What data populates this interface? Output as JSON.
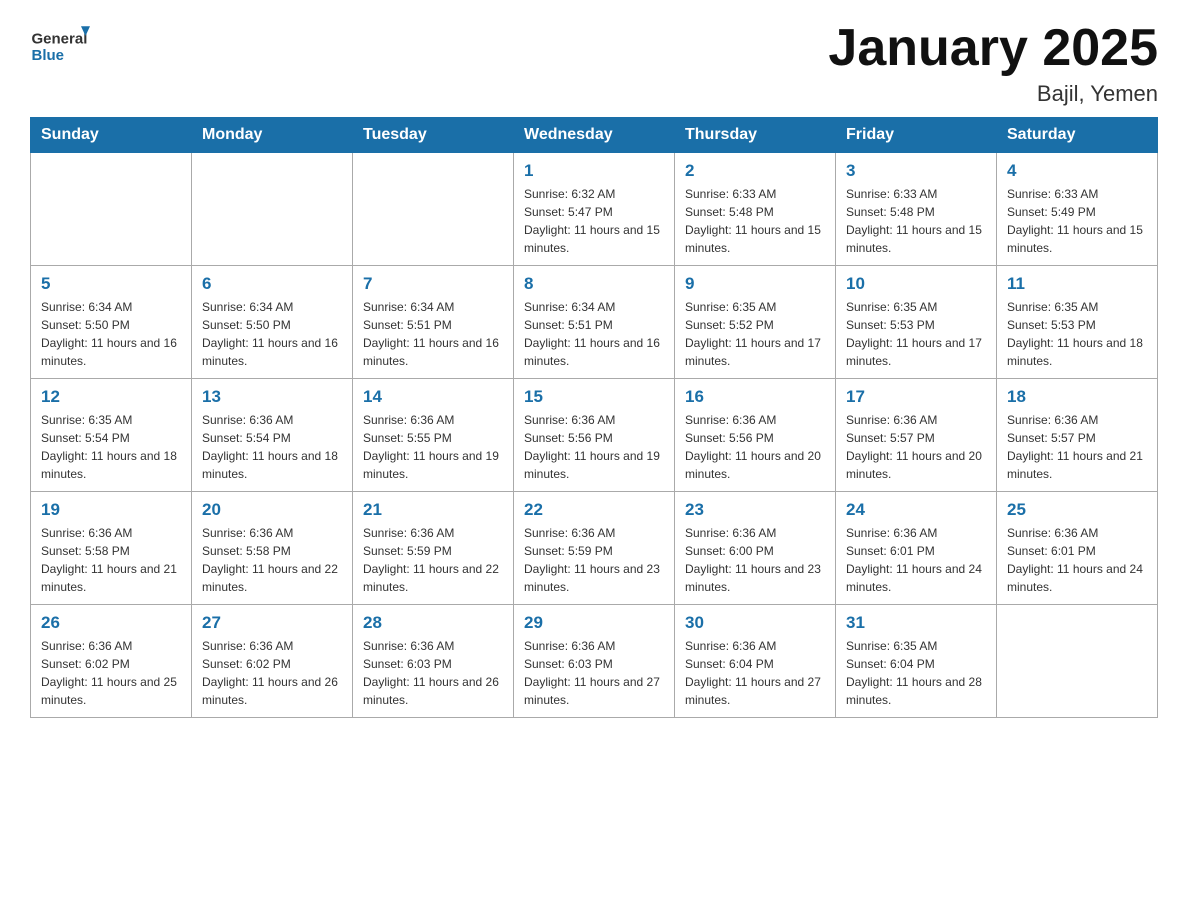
{
  "header": {
    "logo": {
      "general": "General",
      "blue": "Blue"
    },
    "title": "January 2025",
    "location": "Bajil, Yemen"
  },
  "days_of_week": [
    "Sunday",
    "Monday",
    "Tuesday",
    "Wednesday",
    "Thursday",
    "Friday",
    "Saturday"
  ],
  "weeks": [
    [
      {
        "day": "",
        "info": ""
      },
      {
        "day": "",
        "info": ""
      },
      {
        "day": "",
        "info": ""
      },
      {
        "day": "1",
        "info": "Sunrise: 6:32 AM\nSunset: 5:47 PM\nDaylight: 11 hours and 15 minutes."
      },
      {
        "day": "2",
        "info": "Sunrise: 6:33 AM\nSunset: 5:48 PM\nDaylight: 11 hours and 15 minutes."
      },
      {
        "day": "3",
        "info": "Sunrise: 6:33 AM\nSunset: 5:48 PM\nDaylight: 11 hours and 15 minutes."
      },
      {
        "day": "4",
        "info": "Sunrise: 6:33 AM\nSunset: 5:49 PM\nDaylight: 11 hours and 15 minutes."
      }
    ],
    [
      {
        "day": "5",
        "info": "Sunrise: 6:34 AM\nSunset: 5:50 PM\nDaylight: 11 hours and 16 minutes."
      },
      {
        "day": "6",
        "info": "Sunrise: 6:34 AM\nSunset: 5:50 PM\nDaylight: 11 hours and 16 minutes."
      },
      {
        "day": "7",
        "info": "Sunrise: 6:34 AM\nSunset: 5:51 PM\nDaylight: 11 hours and 16 minutes."
      },
      {
        "day": "8",
        "info": "Sunrise: 6:34 AM\nSunset: 5:51 PM\nDaylight: 11 hours and 16 minutes."
      },
      {
        "day": "9",
        "info": "Sunrise: 6:35 AM\nSunset: 5:52 PM\nDaylight: 11 hours and 17 minutes."
      },
      {
        "day": "10",
        "info": "Sunrise: 6:35 AM\nSunset: 5:53 PM\nDaylight: 11 hours and 17 minutes."
      },
      {
        "day": "11",
        "info": "Sunrise: 6:35 AM\nSunset: 5:53 PM\nDaylight: 11 hours and 18 minutes."
      }
    ],
    [
      {
        "day": "12",
        "info": "Sunrise: 6:35 AM\nSunset: 5:54 PM\nDaylight: 11 hours and 18 minutes."
      },
      {
        "day": "13",
        "info": "Sunrise: 6:36 AM\nSunset: 5:54 PM\nDaylight: 11 hours and 18 minutes."
      },
      {
        "day": "14",
        "info": "Sunrise: 6:36 AM\nSunset: 5:55 PM\nDaylight: 11 hours and 19 minutes."
      },
      {
        "day": "15",
        "info": "Sunrise: 6:36 AM\nSunset: 5:56 PM\nDaylight: 11 hours and 19 minutes."
      },
      {
        "day": "16",
        "info": "Sunrise: 6:36 AM\nSunset: 5:56 PM\nDaylight: 11 hours and 20 minutes."
      },
      {
        "day": "17",
        "info": "Sunrise: 6:36 AM\nSunset: 5:57 PM\nDaylight: 11 hours and 20 minutes."
      },
      {
        "day": "18",
        "info": "Sunrise: 6:36 AM\nSunset: 5:57 PM\nDaylight: 11 hours and 21 minutes."
      }
    ],
    [
      {
        "day": "19",
        "info": "Sunrise: 6:36 AM\nSunset: 5:58 PM\nDaylight: 11 hours and 21 minutes."
      },
      {
        "day": "20",
        "info": "Sunrise: 6:36 AM\nSunset: 5:58 PM\nDaylight: 11 hours and 22 minutes."
      },
      {
        "day": "21",
        "info": "Sunrise: 6:36 AM\nSunset: 5:59 PM\nDaylight: 11 hours and 22 minutes."
      },
      {
        "day": "22",
        "info": "Sunrise: 6:36 AM\nSunset: 5:59 PM\nDaylight: 11 hours and 23 minutes."
      },
      {
        "day": "23",
        "info": "Sunrise: 6:36 AM\nSunset: 6:00 PM\nDaylight: 11 hours and 23 minutes."
      },
      {
        "day": "24",
        "info": "Sunrise: 6:36 AM\nSunset: 6:01 PM\nDaylight: 11 hours and 24 minutes."
      },
      {
        "day": "25",
        "info": "Sunrise: 6:36 AM\nSunset: 6:01 PM\nDaylight: 11 hours and 24 minutes."
      }
    ],
    [
      {
        "day": "26",
        "info": "Sunrise: 6:36 AM\nSunset: 6:02 PM\nDaylight: 11 hours and 25 minutes."
      },
      {
        "day": "27",
        "info": "Sunrise: 6:36 AM\nSunset: 6:02 PM\nDaylight: 11 hours and 26 minutes."
      },
      {
        "day": "28",
        "info": "Sunrise: 6:36 AM\nSunset: 6:03 PM\nDaylight: 11 hours and 26 minutes."
      },
      {
        "day": "29",
        "info": "Sunrise: 6:36 AM\nSunset: 6:03 PM\nDaylight: 11 hours and 27 minutes."
      },
      {
        "day": "30",
        "info": "Sunrise: 6:36 AM\nSunset: 6:04 PM\nDaylight: 11 hours and 27 minutes."
      },
      {
        "day": "31",
        "info": "Sunrise: 6:35 AM\nSunset: 6:04 PM\nDaylight: 11 hours and 28 minutes."
      },
      {
        "day": "",
        "info": ""
      }
    ]
  ]
}
